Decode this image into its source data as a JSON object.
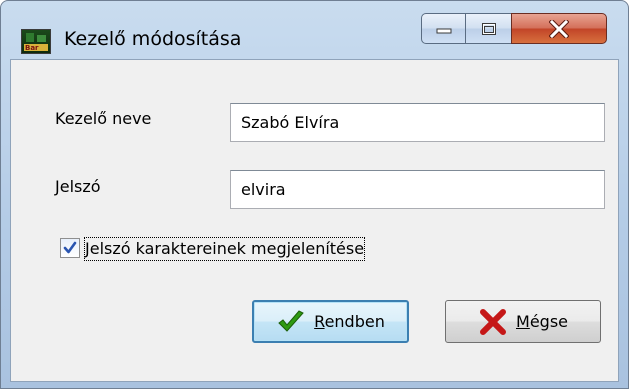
{
  "window": {
    "title": "Kezelő módosítása"
  },
  "form": {
    "name_label": "Kezelő neve",
    "name_value": "Szabó Elvíra",
    "password_label": "Jelszó",
    "password_value": "elvira",
    "show_chars_label": "Jelszó karaktereinek megjelenítése",
    "show_chars_checked": true
  },
  "buttons": {
    "ok_accel": "R",
    "ok_rest": "endben",
    "cancel_accel": "M",
    "cancel_rest": "égse"
  },
  "colors": {
    "check_mark": "#2a55b0",
    "ok_icon": "#2e9a12",
    "cancel_icon": "#c51717"
  },
  "icons": {
    "app": "app-icon",
    "minimize": "minimize-icon",
    "maximize": "maximize-icon",
    "close": "close-icon",
    "ok": "checkmark-icon",
    "cancel": "x-icon"
  }
}
